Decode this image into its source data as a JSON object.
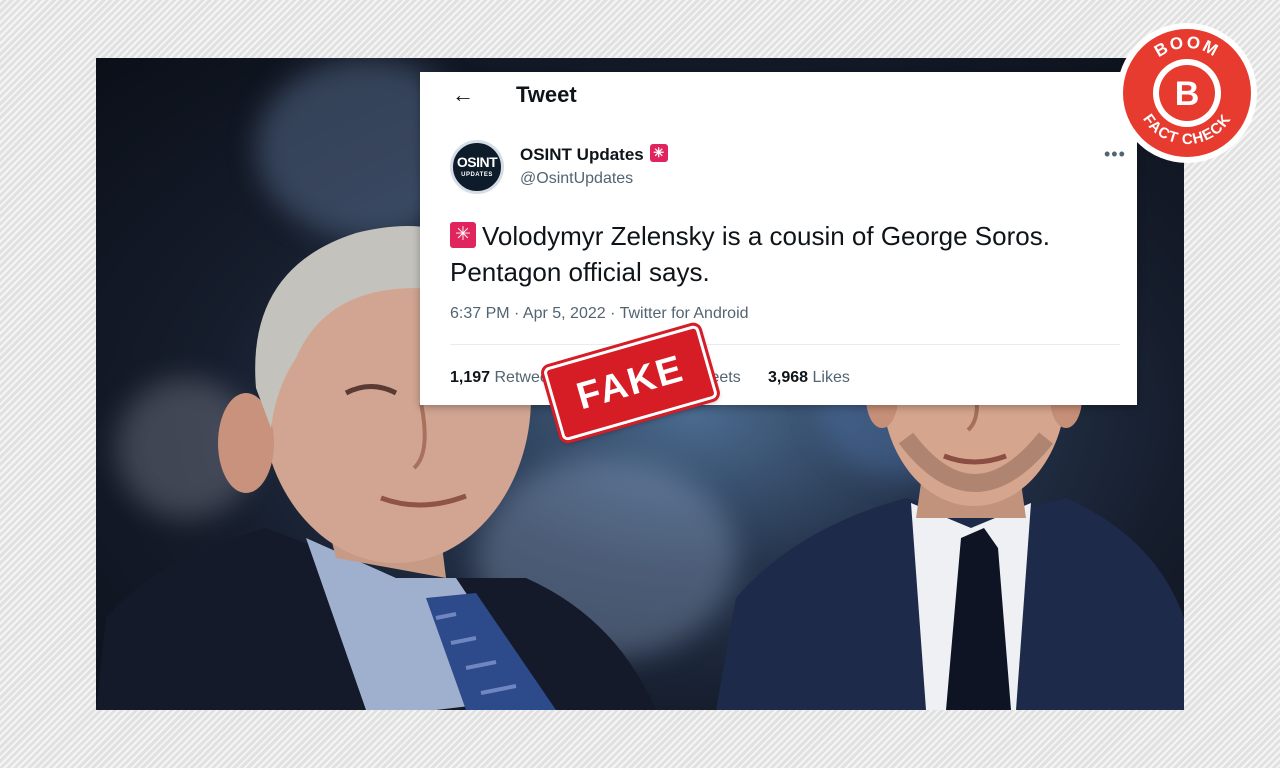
{
  "tweet": {
    "header_title": "Tweet",
    "avatar_line1": "OSINT",
    "avatar_line2": "UPDATES",
    "display_name": "OSINT Updates",
    "handle": "@OsintUpdates",
    "text": "Volodymyr Zelensky is a cousin of George Soros. Pentagon official says.",
    "meta": "6:37 PM · Apr 5, 2022 · Twitter for Android",
    "stats": {
      "retweets_count": "1,197",
      "retweets_label": "Retweets",
      "quote_tweets_label": "Tweets",
      "likes_count": "3,968",
      "likes_label": "Likes"
    }
  },
  "stamp": {
    "label": "FAKE",
    "color": "#d61d26"
  },
  "badge": {
    "top_text": "BOOM",
    "letter": "B",
    "bottom_text": "FACT CHECK",
    "color": "#e63b2e"
  },
  "icons": [
    "back-arrow-icon",
    "siren-emoji-icon",
    "more-options-icon"
  ]
}
